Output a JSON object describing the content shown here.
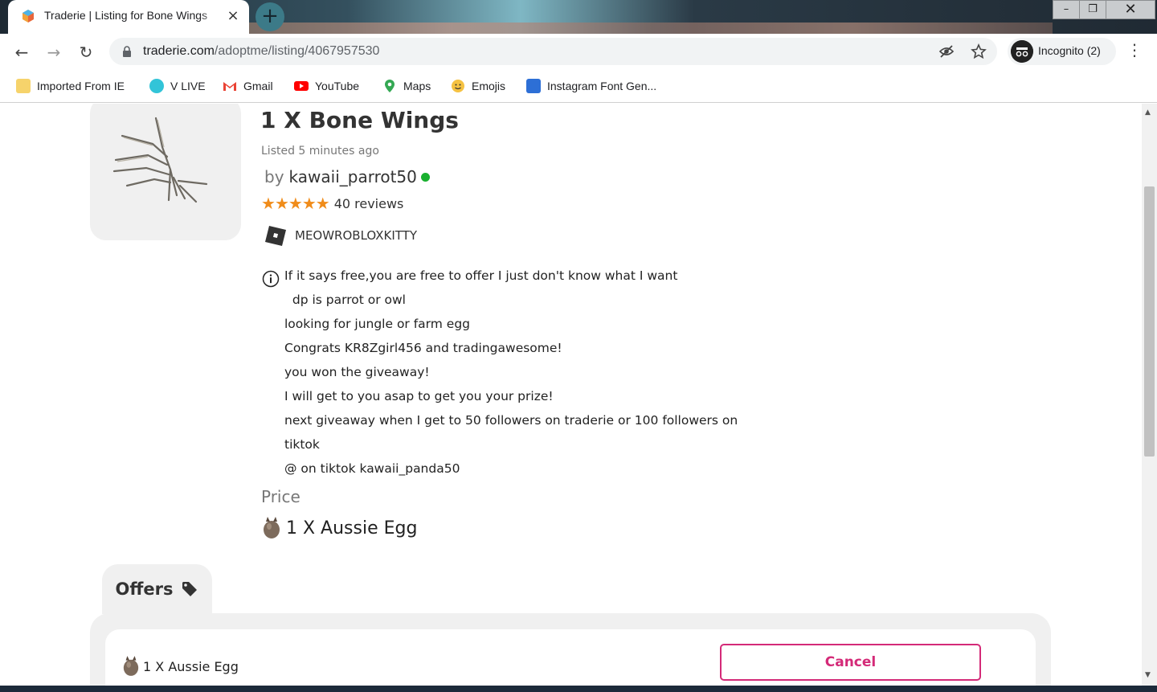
{
  "browser": {
    "tab_title": "Traderie | Listing for Bone Wings",
    "tab_close": "×",
    "new_tab": "+",
    "url_host": "traderie.com",
    "url_path": "/adoptme/listing/4067957530",
    "incognito_label": "Incognito (2)",
    "window_min": "–",
    "window_max": "❐",
    "window_close": "✕",
    "nav_back": "←",
    "nav_forward": "→",
    "nav_reload": "↻",
    "menu": "⋮"
  },
  "bookmarks": [
    {
      "label": "Imported From IE",
      "icon": "folder-icon",
      "color": "#f6d36b"
    },
    {
      "label": "V LIVE",
      "icon": "vlive-icon",
      "color": "#32c4d8"
    },
    {
      "label": "Gmail",
      "icon": "gmail-icon",
      "color": "#ea4335"
    },
    {
      "label": "YouTube",
      "icon": "youtube-icon",
      "color": "#ff0000"
    },
    {
      "label": "Maps",
      "icon": "maps-icon",
      "color": "#34a853"
    },
    {
      "label": "Emojis",
      "icon": "emoji-icon",
      "color": "#f5c242"
    },
    {
      "label": "Instagram Font Gen...",
      "icon": "instagram-font-icon",
      "color": "#2d6fd6"
    }
  ],
  "listing": {
    "title": "1 X Bone Wings",
    "listed": "Listed 5 minutes ago",
    "by_word": "by",
    "seller": "kawaii_parrot50",
    "rating_stars": 5,
    "reviews": "40 reviews",
    "roblox_username": "MEOWROBLOXKITTY",
    "description_lines": [
      "If it says free,you are free to offer I just don't know what I want",
      "  dp is parrot or owl",
      "looking for jungle or farm egg",
      "Congrats KR8Zgirl456 and tradingawesome!",
      "you won the giveaway!",
      "I will get to you asap to get you your prize!",
      "next giveaway when I get to 50 followers on traderie or 100 followers on",
      "tiktok",
      "@ on tiktok kawaii_panda50"
    ],
    "price_label": "Price",
    "price_item": "1 X Aussie Egg"
  },
  "offers": {
    "tab_label": "Offers",
    "items": [
      {
        "label": "1 X Aussie Egg",
        "button": "Cancel"
      }
    ]
  },
  "colors": {
    "accent": "#d42a78",
    "star": "#f08c1a",
    "online": "#19b02f"
  }
}
